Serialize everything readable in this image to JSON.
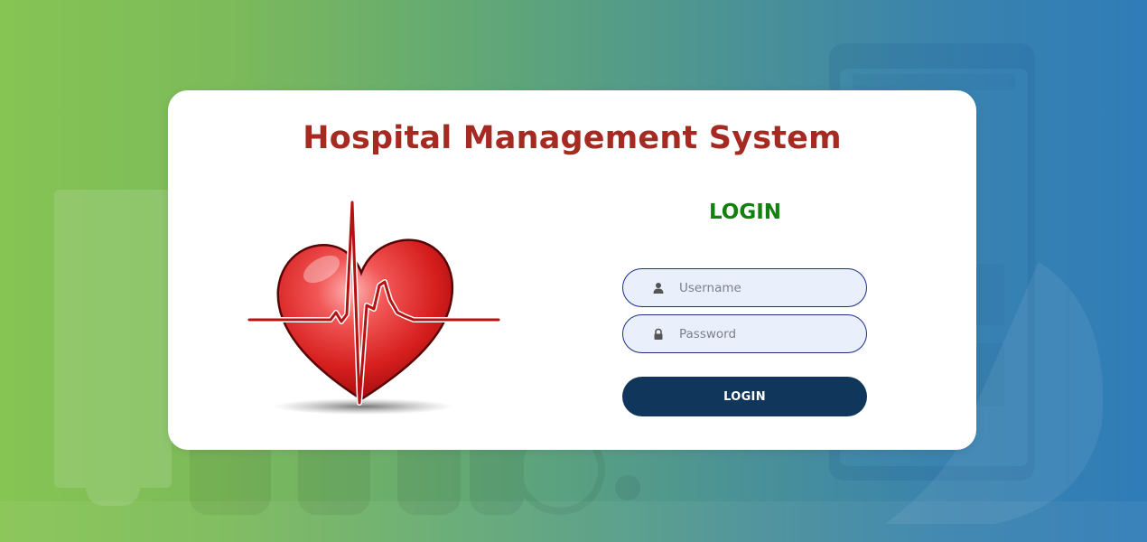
{
  "page": {
    "title": "Hospital Management System"
  },
  "login": {
    "heading": "LOGIN",
    "username_placeholder": "Username",
    "password_placeholder": "Password",
    "button_label": "LOGIN"
  },
  "icons": {
    "username": "user-icon",
    "password": "lock-icon",
    "illustration": "heart-ecg-icon"
  },
  "colors": {
    "title": "#a52a22",
    "login_heading": "#13800f",
    "button_bg": "#11365c",
    "field_border": "#1c2c8c",
    "field_bg": "#e9f0fc",
    "bg_left": "#86c454",
    "bg_right": "#2f7cb8"
  }
}
